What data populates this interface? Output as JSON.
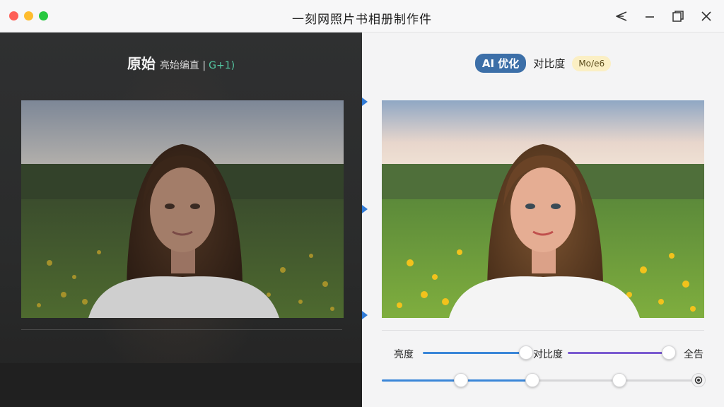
{
  "window": {
    "title": "一刻网照片书相册制作件",
    "controls": [
      "share-icon",
      "minimize-icon",
      "restore-icon",
      "close-icon"
    ]
  },
  "original_panel": {
    "title": "原始",
    "subtitle": "亮始编直 |",
    "accent": "G+1)",
    "image_description": "woman with long wavy brown hair in white blouse, flower meadow background"
  },
  "optimized_panel": {
    "badge_ai": "AI 优化",
    "badge_contrast": "对比度",
    "badge_more": "Mo/e6",
    "image_description": "enhanced version of the same portrait"
  },
  "controls": {
    "brightness_label": "亮度",
    "contrast_label": "对比度",
    "all_label": "全告",
    "brightness_value": 0.73,
    "contrast_value": 1.0,
    "bottom_slider_values": [
      0.25,
      0.47,
      0.75,
      1.0
    ]
  },
  "colors": {
    "accent_blue": "#3c6fa8",
    "slider_blue": "#3a86d8",
    "slider_purple": "#7a5ad0",
    "split_marker": "#2f7ad6",
    "subtitle_accent": "#54c7a2"
  }
}
